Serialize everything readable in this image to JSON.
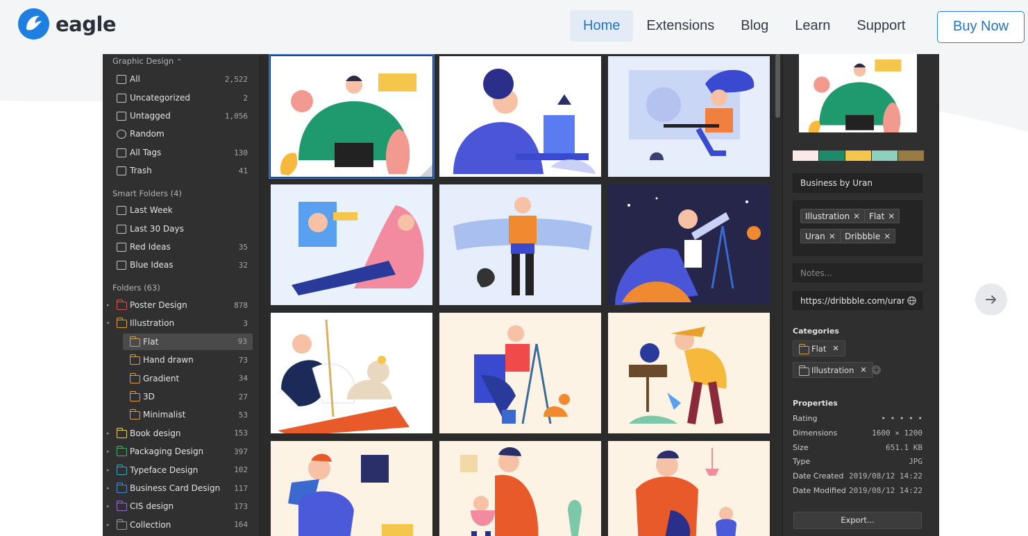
{
  "brand": {
    "name": "eagle"
  },
  "nav": {
    "items": [
      {
        "label": "Home",
        "active": true
      },
      {
        "label": "Extensions",
        "active": false
      },
      {
        "label": "Blog",
        "active": false
      },
      {
        "label": "Learn",
        "active": false
      },
      {
        "label": "Support",
        "active": false
      }
    ],
    "buy_label": "Buy Now"
  },
  "sidebar": {
    "library": "Graphic Design",
    "library_caret": "⌃",
    "library_items": [
      {
        "label": "All",
        "count": "2,522",
        "icon": "all-icon"
      },
      {
        "label": "Uncategorized",
        "count": "2",
        "icon": "uncategorized-icon"
      },
      {
        "label": "Untagged",
        "count": "1,056",
        "icon": "untagged-icon"
      },
      {
        "label": "Random",
        "count": "",
        "icon": "random-icon"
      },
      {
        "label": "All Tags",
        "count": "130",
        "icon": "tags-icon"
      },
      {
        "label": "Trash",
        "count": "41",
        "icon": "trash-icon"
      }
    ],
    "smart_heading": "Smart Folders (4)",
    "smart_items": [
      {
        "label": "Last Week",
        "count": "",
        "icon": "calendar-7-icon"
      },
      {
        "label": "Last 30 Days",
        "count": "",
        "icon": "calendar-31-icon"
      },
      {
        "label": "Red Ideas",
        "count": "35",
        "icon": "smart-folder-icon"
      },
      {
        "label": "Blue Ideas",
        "count": "32",
        "icon": "smart-folder-icon"
      }
    ],
    "folders_heading": "Folders (63)",
    "folders": [
      {
        "label": "Poster Design",
        "count": "878",
        "color": "#d9534f",
        "level": 0,
        "caret": "▸"
      },
      {
        "label": "Illustration",
        "count": "3",
        "color": "#e0a030",
        "level": 0,
        "caret": "▾"
      },
      {
        "label": "Flat",
        "count": "93",
        "color": "#e0a030",
        "level": 1,
        "caret": "",
        "selected": true
      },
      {
        "label": "Hand drawn",
        "count": "73",
        "color": "#e0a030",
        "level": 1,
        "caret": ""
      },
      {
        "label": "Gradient",
        "count": "34",
        "color": "#e0a030",
        "level": 1,
        "caret": ""
      },
      {
        "label": "3D",
        "count": "27",
        "color": "#e0a030",
        "level": 1,
        "caret": ""
      },
      {
        "label": "Minimalist",
        "count": "53",
        "color": "#e0a030",
        "level": 1,
        "caret": ""
      },
      {
        "label": "Book design",
        "count": "153",
        "color": "#e8d24a",
        "level": 0,
        "caret": "▸"
      },
      {
        "label": "Packaging Design",
        "count": "397",
        "color": "#4caf6a",
        "level": 0,
        "caret": "▸"
      },
      {
        "label": "Typeface Design",
        "count": "102",
        "color": "#3aa8b8",
        "level": 0,
        "caret": "▸"
      },
      {
        "label": "Business Card Design",
        "count": "117",
        "color": "#4a8ad4",
        "level": 0,
        "caret": "▸"
      },
      {
        "label": "CIS design",
        "count": "173",
        "color": "#9b6ad4",
        "level": 0,
        "caret": "▸"
      },
      {
        "label": "Collection",
        "count": "164",
        "color": "#9a9a9a",
        "level": 0,
        "caret": "▸"
      }
    ]
  },
  "inspector": {
    "palette": [
      "#fbe9e9",
      "#1f8a6a",
      "#f4c64b",
      "#8fcfbf",
      "#9a7a45"
    ],
    "title": "Business by Uran",
    "tags": [
      "Illustration",
      "Flat",
      "Uran",
      "Dribbble"
    ],
    "tag_remove": "✕",
    "notes_placeholder": "Notes...",
    "url": "https://dribbble.com/uranc",
    "categories_heading": "Categories",
    "categories": [
      "Flat",
      "Illustration"
    ],
    "properties_heading": "Properties",
    "properties": [
      {
        "label": "Rating",
        "value": "• • • • •"
      },
      {
        "label": "Dimensions",
        "value": "1600 × 1200"
      },
      {
        "label": "Size",
        "value": "651.1 KB"
      },
      {
        "label": "Type",
        "value": "JPG"
      },
      {
        "label": "Date Created",
        "value": "2019/08/12 14:22"
      },
      {
        "label": "Date Modified",
        "value": "2019/08/12 14:22"
      }
    ],
    "export_label": "Export..."
  },
  "thumbnails": [
    {
      "name": "business-illustration",
      "bg": "#ffffff",
      "selected": true
    },
    {
      "name": "woman-laptop-bird",
      "bg": "#ffffff"
    },
    {
      "name": "woman-desk-cat",
      "bg": "#e6eefc"
    },
    {
      "name": "woman-phone-chat",
      "bg": "#e8f1fc"
    },
    {
      "name": "man-vr-cat",
      "bg": "#e6eefc"
    },
    {
      "name": "telescope-night",
      "bg": "#26264a"
    },
    {
      "name": "man-cat-fishing",
      "bg": "#ffffff"
    },
    {
      "name": "painter-easel",
      "bg": "#fdf3e5"
    },
    {
      "name": "gardener-watering",
      "bg": "#fdf3e5"
    },
    {
      "name": "man-reading",
      "bg": "#fdf3e5"
    },
    {
      "name": "father-child-painting",
      "bg": "#fdf3e5"
    },
    {
      "name": "mother-child-tea",
      "bg": "#fdf3e5"
    }
  ]
}
